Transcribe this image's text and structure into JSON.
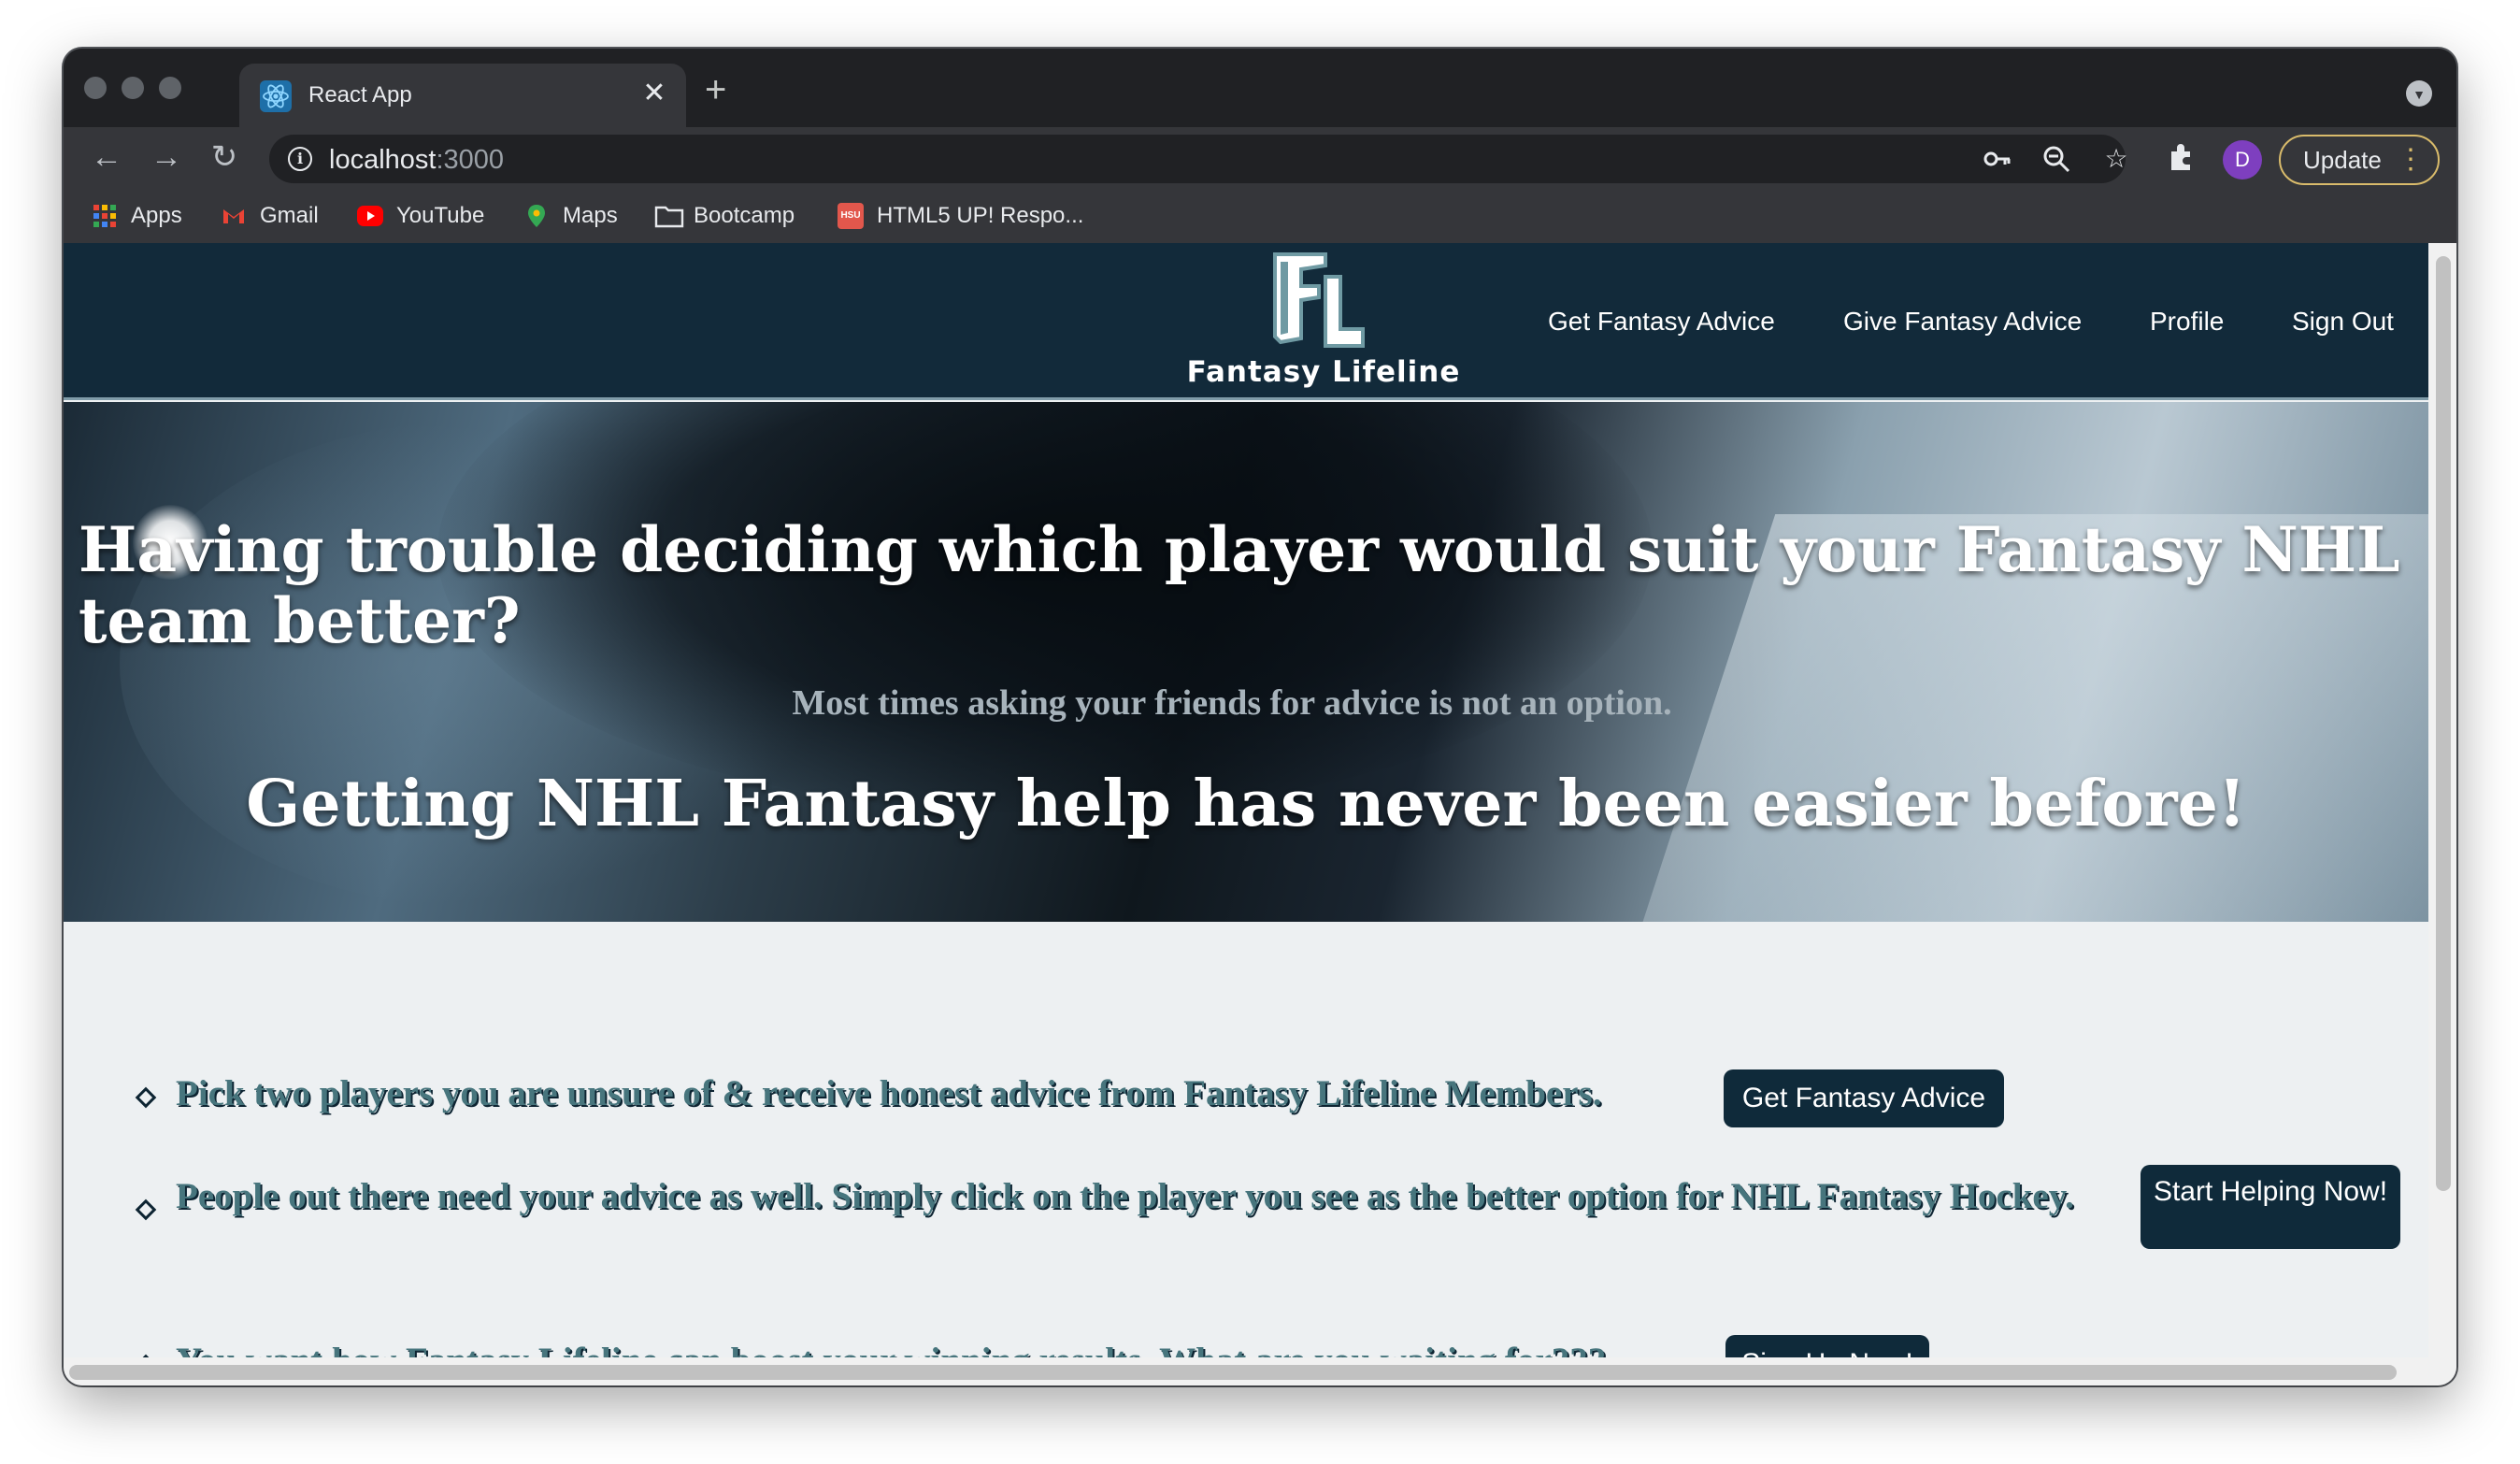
{
  "browser": {
    "tab": {
      "title": "React App",
      "close": "✕"
    },
    "new_tab": "+",
    "address": {
      "host": "localhost",
      "port": ":3000"
    },
    "avatar_letter": "D",
    "update_label": "Update",
    "bookmarks": [
      {
        "label": "Apps",
        "icon": "apps-grid-icon"
      },
      {
        "label": "Gmail",
        "icon": "gmail-icon"
      },
      {
        "label": "YouTube",
        "icon": "youtube-icon"
      },
      {
        "label": "Maps",
        "icon": "maps-pin-icon"
      },
      {
        "label": "Bootcamp",
        "icon": "folder-icon"
      },
      {
        "label": "HTML5 UP! Respo...",
        "icon": "hsu-icon"
      }
    ]
  },
  "site": {
    "logo_text": "Fantasy Lifeline",
    "nav": [
      "Get Fantasy Advice",
      "Give Fantasy Advice",
      "Profile",
      "Sign Out"
    ],
    "hero": {
      "headline": "Having trouble deciding which player would suit your Fantasy NHL team better?",
      "subline": "Most times asking your friends for advice is not an option.",
      "tagline": "Getting NHL Fantasy help has never been easier before!"
    },
    "features": [
      {
        "text": "Pick two players you are unsure of & receive honest advice from Fantasy Lifeline Members.",
        "button": "Get Fantasy Advice"
      },
      {
        "text": "People out there need your advice as well. Simply click on the player you see as the better option for NHL Fantasy Hockey.",
        "button": "Start Helping Now!"
      },
      {
        "text": "You want how Fantasy Lifeline can boost your winning results. What are you waiting for???",
        "button": "Sign Up Now!"
      }
    ]
  },
  "colors": {
    "header_bg": "#122a3a",
    "button_bg": "#0f2a3a",
    "feature_text": "#47757d",
    "update_border": "#d9bb6b",
    "avatar": "#7e3fbf"
  }
}
